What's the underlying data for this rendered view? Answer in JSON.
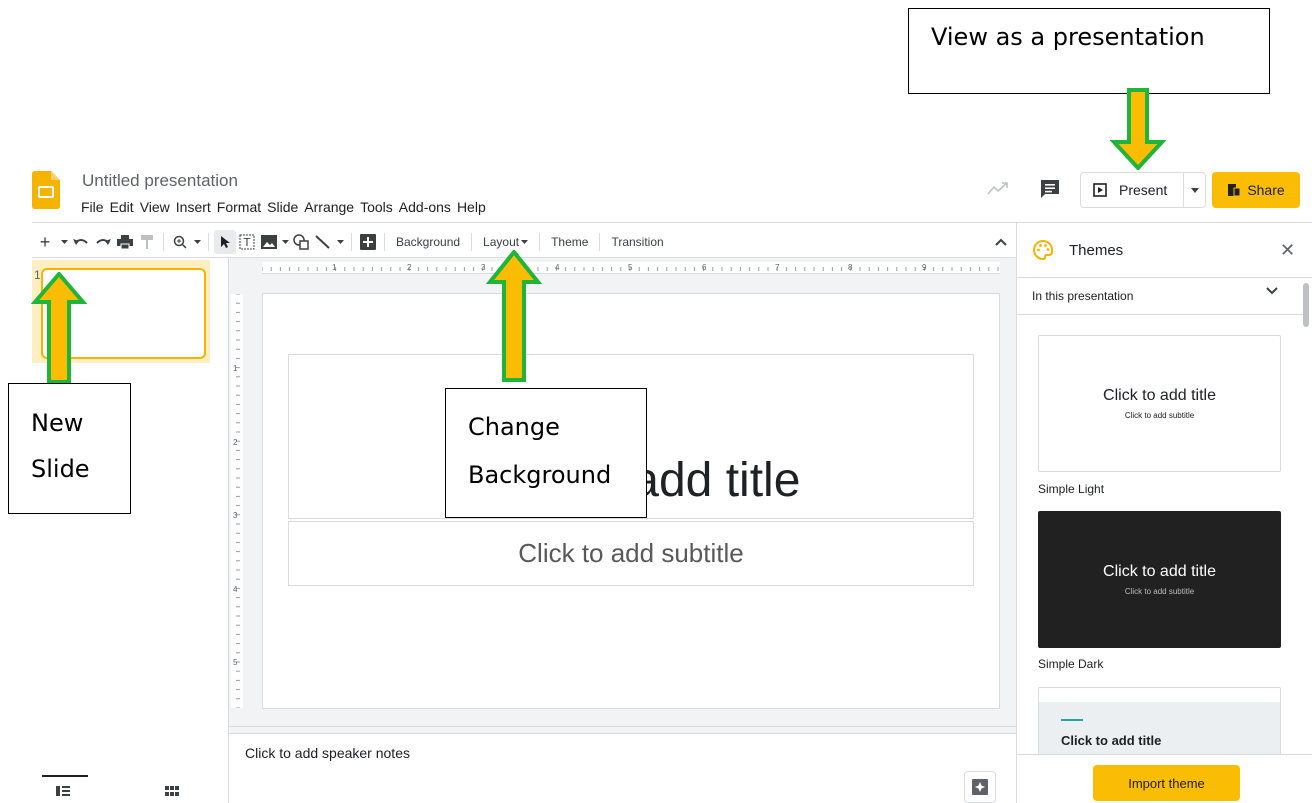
{
  "document": {
    "title": "Untitled presentation"
  },
  "menu": [
    "File",
    "Edit",
    "View",
    "Insert",
    "Format",
    "Slide",
    "Arrange",
    "Tools",
    "Add-ons",
    "Help"
  ],
  "header": {
    "present_label": "Present",
    "share_label": "Share"
  },
  "toolbar": {
    "background": "Background",
    "layout": "Layout",
    "theme": "Theme",
    "transition": "Transition"
  },
  "ruler": {
    "top": [
      "1",
      "2",
      "3",
      "4",
      "5",
      "6",
      "7",
      "8",
      "9"
    ],
    "left": [
      "1",
      "2",
      "3",
      "4",
      "5"
    ]
  },
  "filmstrip": {
    "slide_number": "1"
  },
  "slide": {
    "title_placeholder": "Click to add title",
    "subtitle_placeholder": "Click to add subtitle"
  },
  "notes": {
    "placeholder": "Click to add speaker notes"
  },
  "themes": {
    "title": "Themes",
    "section": "In this presentation",
    "items": [
      {
        "name": "Simple Light",
        "title": "Click to add title",
        "subtitle": "Click to add subtitle"
      },
      {
        "name": "Simple Dark",
        "title": "Click to add title",
        "subtitle": "Click to add subtitle"
      },
      {
        "name": "",
        "title": "Click to add title",
        "subtitle": ""
      }
    ],
    "import_label": "Import theme"
  },
  "annotations": {
    "view_present": "View as a presentation",
    "new_slide_1": "New",
    "new_slide_2": "Slide",
    "change_bg_1": "Change",
    "change_bg_2": "Background"
  },
  "colors": {
    "accent_yellow": "#fbbc04",
    "arrow_fill": "#fbbc04",
    "arrow_stroke": "#1eb53a"
  }
}
